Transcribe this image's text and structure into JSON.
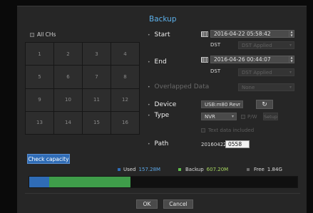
{
  "title": "Backup",
  "all_chs_label": "All CHs",
  "channels": [
    "1",
    "2",
    "3",
    "4",
    "5",
    "6",
    "7",
    "8",
    "9",
    "10",
    "11",
    "12",
    "13",
    "14",
    "15",
    "16"
  ],
  "start": {
    "label": "Start",
    "datetime": "2016-04-22  05:58:42",
    "dst_label": "DST",
    "dst_value": "DST Applied"
  },
  "end": {
    "label": "End",
    "datetime": "2016-04-26  00:44:07",
    "dst_label": "DST",
    "dst_value": "DST Applied"
  },
  "overlapped": {
    "label": "Overlapped Data",
    "value": "None"
  },
  "device": {
    "label": "Device",
    "value": "USB:m80 Rev:"
  },
  "type": {
    "label": "Type",
    "value": "NVR",
    "pw_label": "P/W",
    "setup_label": "Setup"
  },
  "text_data_label": "Text data included",
  "path": {
    "label": "Path",
    "prefix": "20160422",
    "value": "0558"
  },
  "check_capacity_label": "Check capacity",
  "capacity": {
    "used_label": "Used",
    "used_value": "157.28M",
    "used_color": "#2f6cb6",
    "used_fraction": 0.074,
    "backup_label": "Backup",
    "backup_value": "607.20M",
    "backup_color": "#3f9d4a",
    "backup_fraction": 0.303,
    "free_label": "Free",
    "free_value": "1.84G",
    "free_color": "#3a3a3a"
  },
  "ok_label": "OK",
  "cancel_label": "Cancel",
  "icons": {
    "calendar": "calendar-icon",
    "refresh": "refresh-icon"
  }
}
